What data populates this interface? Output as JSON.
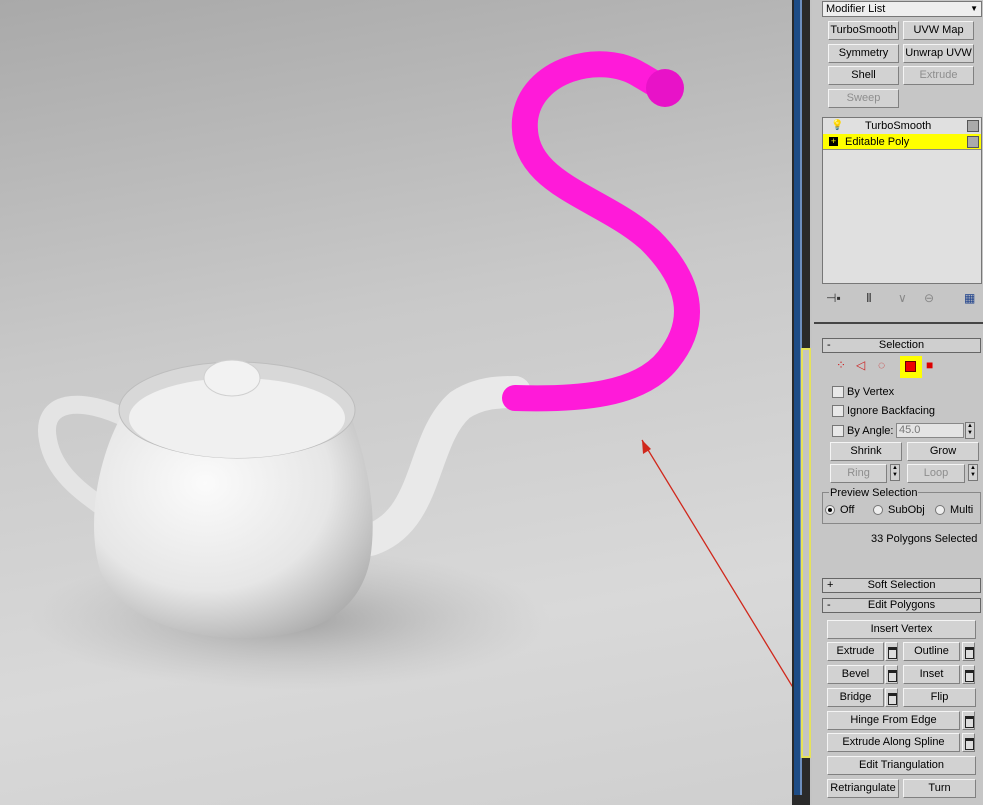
{
  "modifier_list": {
    "label": "Modifier List"
  },
  "modifier_buttons": [
    {
      "label": "TurboSmooth",
      "enabled": true
    },
    {
      "label": "UVW Map",
      "enabled": true
    },
    {
      "label": "Symmetry",
      "enabled": true
    },
    {
      "label": "Unwrap UVW",
      "enabled": true
    },
    {
      "label": "Shell",
      "enabled": true
    },
    {
      "label": "Extrude",
      "enabled": false
    },
    {
      "label": "Sweep",
      "enabled": false
    }
  ],
  "stack": [
    {
      "label": "TurboSmooth",
      "icon": "lightbulb-icon"
    },
    {
      "label": "Editable Poly",
      "icon": "plus-box-icon",
      "selected": true
    }
  ],
  "selection": {
    "title": "Selection",
    "collapse": "-",
    "by_vertex": "By Vertex",
    "ignore_backfacing": "Ignore Backfacing",
    "by_angle": "By Angle:",
    "angle_value": "45.0",
    "shrink": "Shrink",
    "grow": "Grow",
    "ring": "Ring",
    "loop": "Loop",
    "preview_title": "Preview Selection",
    "off": "Off",
    "subobj": "SubObj",
    "multi": "Multi",
    "status": "33 Polygons Selected"
  },
  "soft_selection": {
    "title": "Soft Selection",
    "expand": "+"
  },
  "edit_polygons": {
    "title": "Edit Polygons",
    "collapse": "-",
    "insert_vertex": "Insert Vertex",
    "extrude": "Extrude",
    "outline": "Outline",
    "bevel": "Bevel",
    "inset": "Inset",
    "bridge": "Bridge",
    "flip": "Flip",
    "hinge": "Hinge From Edge",
    "extrude_spline": "Extrude Along Spline",
    "edit_tri": "Edit Triangulation",
    "retri": "Retriangulate",
    "turn": "Turn"
  },
  "colors": {
    "selected_poly": "#ff1ad9",
    "highlight": "#ffff00",
    "arrow": "#d0281c"
  }
}
